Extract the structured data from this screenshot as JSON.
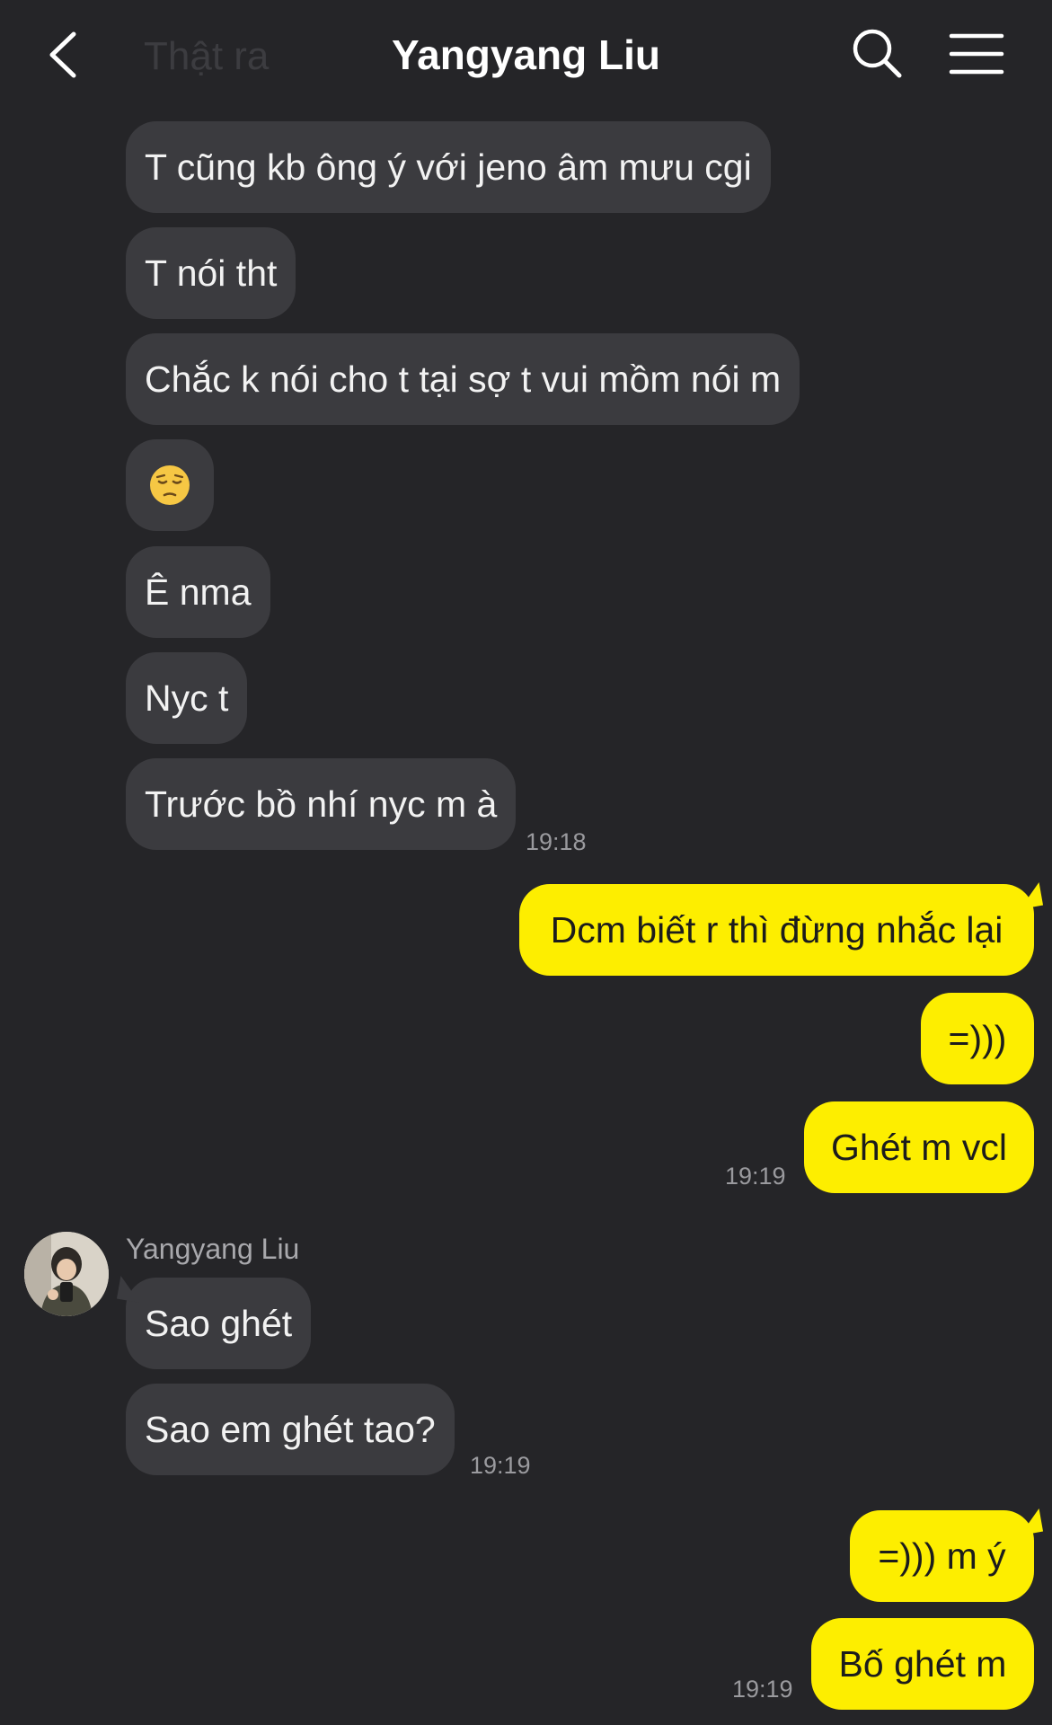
{
  "header": {
    "title": "Yangyang Liu",
    "ghost_text": "Thật ra"
  },
  "colors": {
    "background": "#252528",
    "received_bubble": "#3b3b3f",
    "sent_bubble": "#fdee00",
    "timestamp": "#9a9a9e"
  },
  "icons": {
    "back": "chevron-left-icon",
    "search": "search-icon",
    "menu": "hamburger-menu-icon",
    "emoji": "pensive-face-emoji"
  },
  "messages": [
    {
      "text": "T cũng kb ông ý với jeno âm mưu cgi",
      "from": "them"
    },
    {
      "text": "T nói tht",
      "from": "them"
    },
    {
      "text": "Chắc k nói cho t tại sợ t vui mồm nói m",
      "from": "them"
    },
    {
      "text": "",
      "from": "them",
      "emoji": "pensive-face"
    },
    {
      "text": "Ê nma",
      "from": "them"
    },
    {
      "text": "Nyc t",
      "from": "them"
    },
    {
      "text": "Trước bồ nhí nyc m à",
      "from": "them",
      "time": "19:18"
    },
    {
      "text": "Dcm biết r thì đừng nhắc lại",
      "from": "me"
    },
    {
      "text": "=)))",
      "from": "me"
    },
    {
      "text": "Ghét m vcl",
      "from": "me",
      "time": "19:19"
    },
    {
      "text": "Sao ghét",
      "from": "them",
      "sender": "Yangyang Liu"
    },
    {
      "text": "Sao em ghét tao?",
      "from": "them",
      "time": "19:19"
    },
    {
      "text": "=))) m ý",
      "from": "me"
    },
    {
      "text": "Bố ghét m",
      "from": "me",
      "time": "19:19"
    }
  ]
}
